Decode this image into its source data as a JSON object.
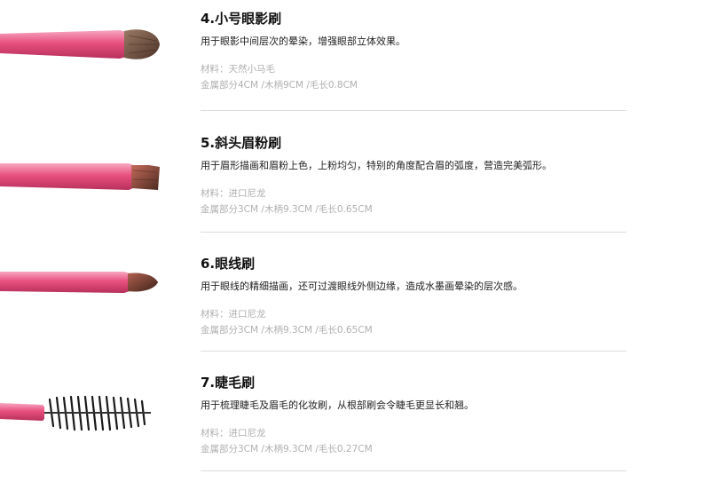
{
  "brushes": [
    {
      "title": "4.小号眼影刷",
      "description": "用于眼影中间层次的晕染，增强眼部立体效果。",
      "material": "材料：天然小马毛",
      "spec": "金属部分4CM /木柄9CM /毛长0.8CM"
    },
    {
      "title": "5.斜头眉粉刷",
      "description": "用于眉形描画和眉粉上色，上粉均匀，特别的角度配合眉的弧度，营造完美弧形。",
      "material": "材料：进口尼龙",
      "spec": "金属部分3CM /木柄9.3CM /毛长0.65CM"
    },
    {
      "title": "6.眼线刷",
      "description": "用于眼线的精细描画，还可过渡眼线外侧边缘，造成水墨画晕染的层次感。",
      "material": "材料：进口尼龙",
      "spec": "金属部分3CM /木柄9.3CM /毛长0.65CM"
    },
    {
      "title": "7.睫毛刷",
      "description": "用于梳理睫毛及眉毛的化妆刷，从根部刷会令睫毛更显长和翘。",
      "material": "材料：进口尼龙",
      "spec": "金属部分3CM /木柄9.3CM /毛长0.27CM"
    }
  ],
  "colors": {
    "handle_pink": "#e8507f",
    "ferrule_pink": "#f07fa3",
    "bristle_brown": "#6b4a3a",
    "spoolie_black": "#1a1a1a"
  }
}
